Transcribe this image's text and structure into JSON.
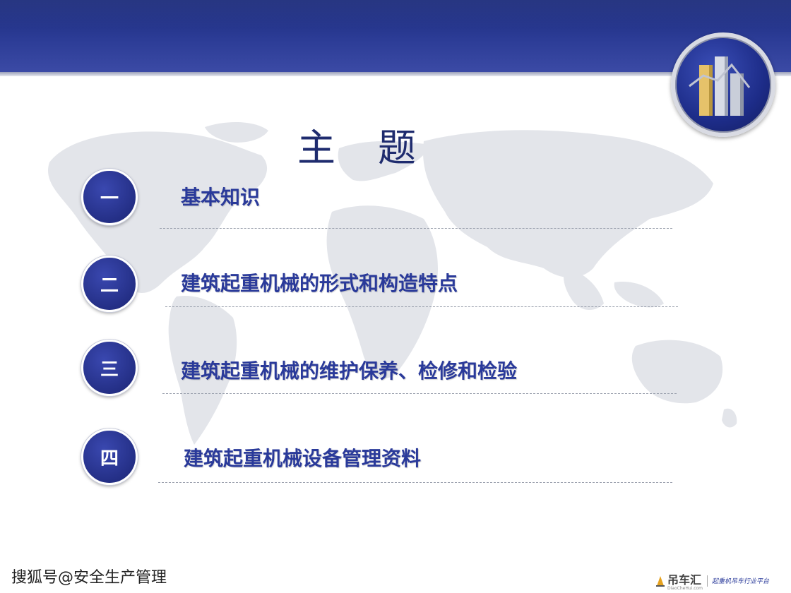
{
  "title": "主题",
  "items": [
    {
      "number": "一",
      "label": "基本知识"
    },
    {
      "number": "二",
      "label": "建筑起重机械的形式和构造特点"
    },
    {
      "number": "三",
      "label": "建筑起重机械的维护保养、检修和检验"
    },
    {
      "number": "四",
      "label": "建筑起重机械设备管理资料"
    }
  ],
  "watermark": "搜狐号@安全生产管理",
  "brand": {
    "name": "吊车汇",
    "domain": "DiaoCheHui.com",
    "tagline": "起重机吊车行业平台"
  },
  "colors": {
    "header": "#2c3c96",
    "badge": "#242f86",
    "label": "#2a3a9a",
    "title": "#1e2b6e"
  },
  "icons": [
    "bar-chart-logo-icon",
    "brand-logo-icon"
  ]
}
